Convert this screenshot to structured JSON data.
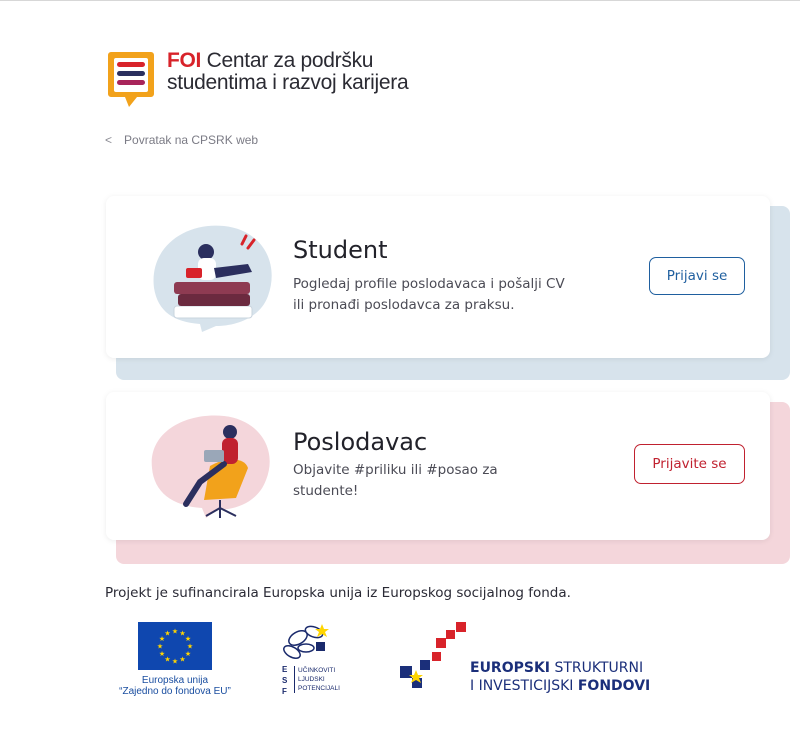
{
  "logo": {
    "brand": "FOI",
    "line1": "Centar za podršku",
    "line2": "studentima i razvoj karijera"
  },
  "back_link": {
    "chevron": "<",
    "label": "Povratak na CPSRK web"
  },
  "cards": [
    {
      "title": "Student",
      "description": "Pogledaj profile poslodavaca i pošalji CV ili pronađi poslodavca za praksu.",
      "button_label": "Prijavi se",
      "accent": "#1f5f9f",
      "shadow_color": "#d7e3ec",
      "illustration": "student-reading-illustration"
    },
    {
      "title": "Poslodavac",
      "description": "Objavite #priliku ili #posao za studente!",
      "button_label": "Prijavite se",
      "accent": "#c0212f",
      "shadow_color": "#f4d6db",
      "illustration": "employer-laptop-illustration"
    }
  ],
  "footer": {
    "funding_text": "Projekt je sufinancirala Europska unija iz Europskog socijalnog fonda.",
    "eu_caption_1": "Europska unija",
    "eu_caption_2": "“Zajedno do fondova EU”",
    "esf_letters": [
      "E",
      "S",
      "F"
    ],
    "esf_words": [
      "UČINKOVITI",
      "LJUDSKI",
      "POTENCIJALI"
    ],
    "esif_line1_bold": "EUROPSKI",
    "esif_line1_rest": " STRUKTURNI",
    "esif_line2_rest": "I INVESTICIJSKI ",
    "esif_line2_bold": "FONDOVI"
  },
  "colors": {
    "brand_red": "#d8232a",
    "brand_orange": "#f2a21b",
    "brand_navy": "#2b2f5e",
    "eu_blue": "#0f47af",
    "eu_star": "#ffd500"
  }
}
